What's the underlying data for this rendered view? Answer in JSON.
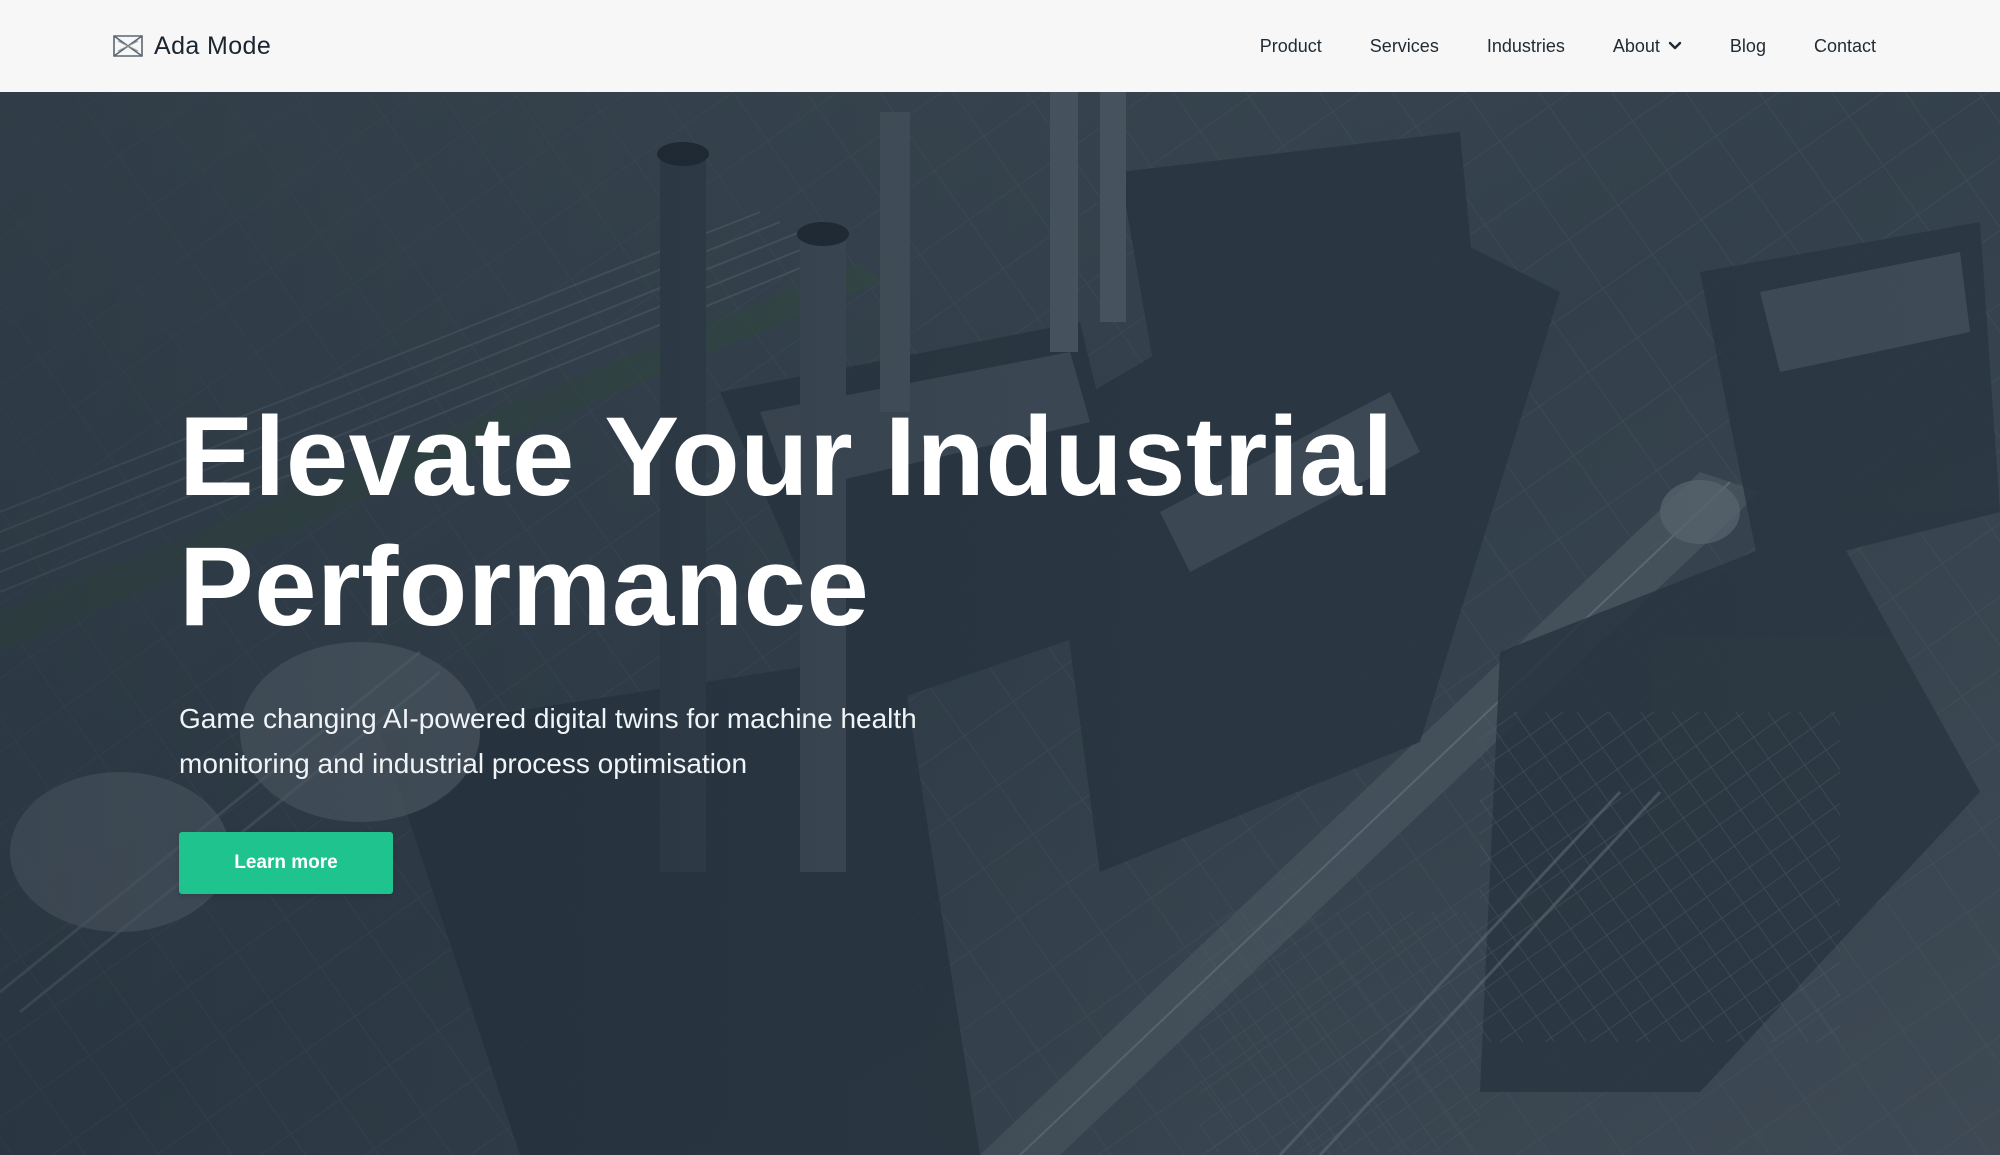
{
  "brand": {
    "name": "Ada Mode",
    "logo_icon": "ada-mode-logo-icon"
  },
  "nav": {
    "items": [
      {
        "label": "Product"
      },
      {
        "label": "Services"
      },
      {
        "label": "Industries"
      },
      {
        "label": "About",
        "has_dropdown": true,
        "icon": "chevron-down-icon"
      },
      {
        "label": "Blog"
      },
      {
        "label": "Contact"
      }
    ]
  },
  "hero": {
    "title_line1": "Elevate Your Industrial",
    "title_line2": "Performance",
    "subtitle_line1": "Game changing AI-powered digital twins for machine health",
    "subtitle_line2": "monitoring and industrial process optimisation",
    "cta_label": "Learn more",
    "background": "aerial-industrial-plant-photo"
  },
  "colors": {
    "header_bg": "#f7f7f7",
    "accent": "#1fc38d",
    "text_dark": "#1b2530",
    "hero_overlay": "#1e2c39"
  }
}
